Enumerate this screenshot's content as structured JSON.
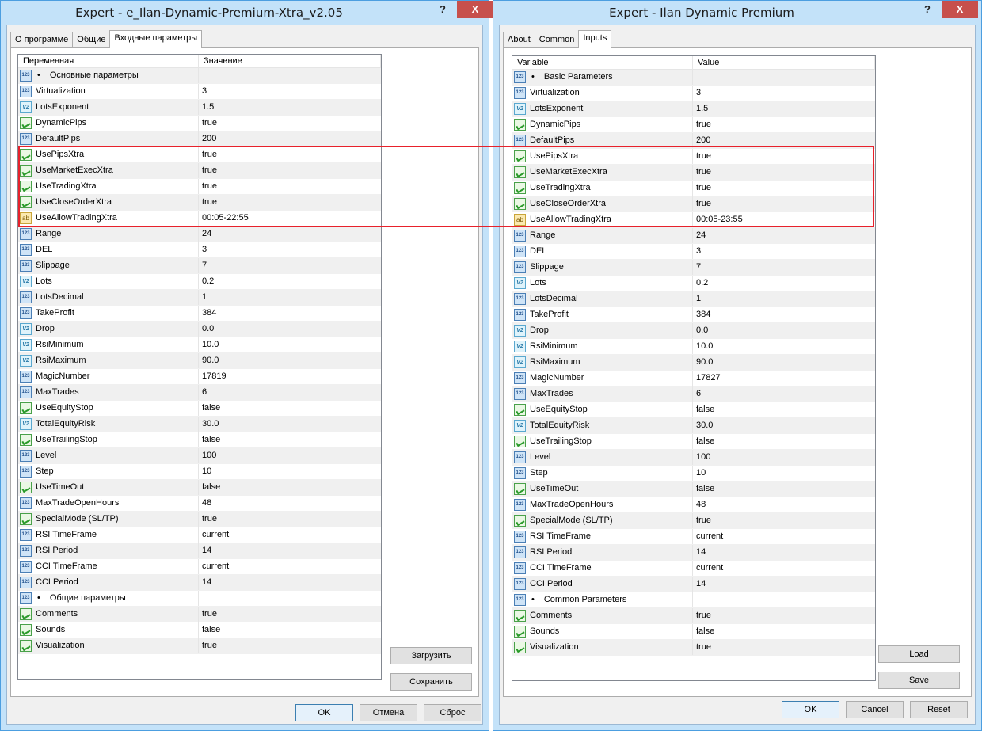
{
  "left_window": {
    "title": "Expert - e_Ilan-Dynamic-Premium-Xtra_v2.05",
    "help": "?",
    "close": "X",
    "tabs": [
      "О программе",
      "Общие",
      "Входные параметры"
    ],
    "col_variable": "Переменная",
    "col_value": "Значение",
    "rows": [
      {
        "type": "section",
        "name": "Основные параметры",
        "value": ""
      },
      {
        "type": "int",
        "name": "Virtualization",
        "value": "3"
      },
      {
        "type": "double",
        "name": "LotsExponent",
        "value": "1.5"
      },
      {
        "type": "bool",
        "name": "DynamicPips",
        "value": "true"
      },
      {
        "type": "int",
        "name": "DefaultPips",
        "value": "200"
      },
      {
        "type": "bool",
        "name": "UsePipsXtra",
        "value": "true"
      },
      {
        "type": "bool",
        "name": "UseMarketExecXtra",
        "value": "true"
      },
      {
        "type": "bool",
        "name": "UseTradingXtra",
        "value": "true"
      },
      {
        "type": "bool",
        "name": "UseCloseOrderXtra",
        "value": "true"
      },
      {
        "type": "string",
        "name": "UseAllowTradingXtra",
        "value": "00:05-22:55"
      },
      {
        "type": "int",
        "name": "Range",
        "value": "24"
      },
      {
        "type": "int",
        "name": "DEL",
        "value": "3"
      },
      {
        "type": "int",
        "name": "Slippage",
        "value": "7"
      },
      {
        "type": "double",
        "name": "Lots",
        "value": "0.2"
      },
      {
        "type": "int",
        "name": "LotsDecimal",
        "value": "1"
      },
      {
        "type": "int",
        "name": "TakeProfit",
        "value": "384"
      },
      {
        "type": "double",
        "name": "Drop",
        "value": "0.0"
      },
      {
        "type": "double",
        "name": "RsiMinimum",
        "value": "10.0"
      },
      {
        "type": "double",
        "name": "RsiMaximum",
        "value": "90.0"
      },
      {
        "type": "int",
        "name": "MagicNumber",
        "value": "17819"
      },
      {
        "type": "int",
        "name": "MaxTrades",
        "value": "6"
      },
      {
        "type": "bool",
        "name": "UseEquityStop",
        "value": "false"
      },
      {
        "type": "double",
        "name": "TotalEquityRisk",
        "value": "30.0"
      },
      {
        "type": "bool",
        "name": "UseTrailingStop",
        "value": "false"
      },
      {
        "type": "int",
        "name": "Level",
        "value": "100"
      },
      {
        "type": "int",
        "name": "Step",
        "value": "10"
      },
      {
        "type": "bool",
        "name": "UseTimeOut",
        "value": "false"
      },
      {
        "type": "int",
        "name": "MaxTradeOpenHours",
        "value": "48"
      },
      {
        "type": "bool",
        "name": "SpecialMode (SL/TP)",
        "value": "true"
      },
      {
        "type": "int",
        "name": "RSI TimeFrame",
        "value": "current"
      },
      {
        "type": "int",
        "name": "RSI Period",
        "value": "14"
      },
      {
        "type": "int",
        "name": "CCI TimeFrame",
        "value": "current"
      },
      {
        "type": "int",
        "name": "CCI Period",
        "value": "14"
      },
      {
        "type": "section",
        "name": "Общие параметры",
        "value": ""
      },
      {
        "type": "bool",
        "name": "Comments",
        "value": "true"
      },
      {
        "type": "bool",
        "name": "Sounds",
        "value": "false"
      },
      {
        "type": "bool",
        "name": "Visualization",
        "value": "true"
      }
    ],
    "load_btn": "Загрузить",
    "save_btn": "Сохранить",
    "ok_btn": "OK",
    "cancel_btn": "Отмена",
    "reset_btn": "Сброс"
  },
  "right_window": {
    "title": "Expert - Ilan Dynamic Premium",
    "help": "?",
    "close": "X",
    "tabs": [
      "About",
      "Common",
      "Inputs"
    ],
    "col_variable": "Variable",
    "col_value": "Value",
    "rows": [
      {
        "type": "section",
        "name": "Basic Parameters",
        "value": ""
      },
      {
        "type": "int",
        "name": "Virtualization",
        "value": "3"
      },
      {
        "type": "double",
        "name": "LotsExponent",
        "value": "1.5"
      },
      {
        "type": "bool",
        "name": "DynamicPips",
        "value": "true"
      },
      {
        "type": "int",
        "name": "DefaultPips",
        "value": "200"
      },
      {
        "type": "bool",
        "name": "UsePipsXtra",
        "value": "true"
      },
      {
        "type": "bool",
        "name": "UseMarketExecXtra",
        "value": "true"
      },
      {
        "type": "bool",
        "name": "UseTradingXtra",
        "value": "true"
      },
      {
        "type": "bool",
        "name": "UseCloseOrderXtra",
        "value": "true"
      },
      {
        "type": "string",
        "name": "UseAllowTradingXtra",
        "value": "00:05-23:55"
      },
      {
        "type": "int",
        "name": "Range",
        "value": "24"
      },
      {
        "type": "int",
        "name": "DEL",
        "value": "3"
      },
      {
        "type": "int",
        "name": "Slippage",
        "value": "7"
      },
      {
        "type": "double",
        "name": "Lots",
        "value": "0.2"
      },
      {
        "type": "int",
        "name": "LotsDecimal",
        "value": "1"
      },
      {
        "type": "int",
        "name": "TakeProfit",
        "value": "384"
      },
      {
        "type": "double",
        "name": "Drop",
        "value": "0.0"
      },
      {
        "type": "double",
        "name": "RsiMinimum",
        "value": "10.0"
      },
      {
        "type": "double",
        "name": "RsiMaximum",
        "value": "90.0"
      },
      {
        "type": "int",
        "name": "MagicNumber",
        "value": "17827"
      },
      {
        "type": "int",
        "name": "MaxTrades",
        "value": "6"
      },
      {
        "type": "bool",
        "name": "UseEquityStop",
        "value": "false"
      },
      {
        "type": "double",
        "name": "TotalEquityRisk",
        "value": "30.0"
      },
      {
        "type": "bool",
        "name": "UseTrailingStop",
        "value": "false"
      },
      {
        "type": "int",
        "name": "Level",
        "value": "100"
      },
      {
        "type": "int",
        "name": "Step",
        "value": "10"
      },
      {
        "type": "bool",
        "name": "UseTimeOut",
        "value": "false"
      },
      {
        "type": "int",
        "name": "MaxTradeOpenHours",
        "value": "48"
      },
      {
        "type": "bool",
        "name": "SpecialMode (SL/TP)",
        "value": "true"
      },
      {
        "type": "int",
        "name": "RSI TimeFrame",
        "value": "current"
      },
      {
        "type": "int",
        "name": "RSI Period",
        "value": "14"
      },
      {
        "type": "int",
        "name": "CCI TimeFrame",
        "value": "current"
      },
      {
        "type": "int",
        "name": "CCI Period",
        "value": "14"
      },
      {
        "type": "section",
        "name": "Common Parameters",
        "value": ""
      },
      {
        "type": "bool",
        "name": "Comments",
        "value": "true"
      },
      {
        "type": "bool",
        "name": "Sounds",
        "value": "false"
      },
      {
        "type": "bool",
        "name": "Visualization",
        "value": "true"
      }
    ],
    "load_btn": "Load",
    "save_btn": "Save",
    "ok_btn": "OK",
    "cancel_btn": "Cancel",
    "reset_btn": "Reset"
  },
  "icon_labels": {
    "int": "123",
    "double": "V2",
    "string": "ab",
    "bool": "",
    "section": "123"
  },
  "section_bullet": "•",
  "colors": {
    "highlight": "#e8212b",
    "window_frame": "#c3e2f9",
    "close_button": "#c7504c"
  }
}
